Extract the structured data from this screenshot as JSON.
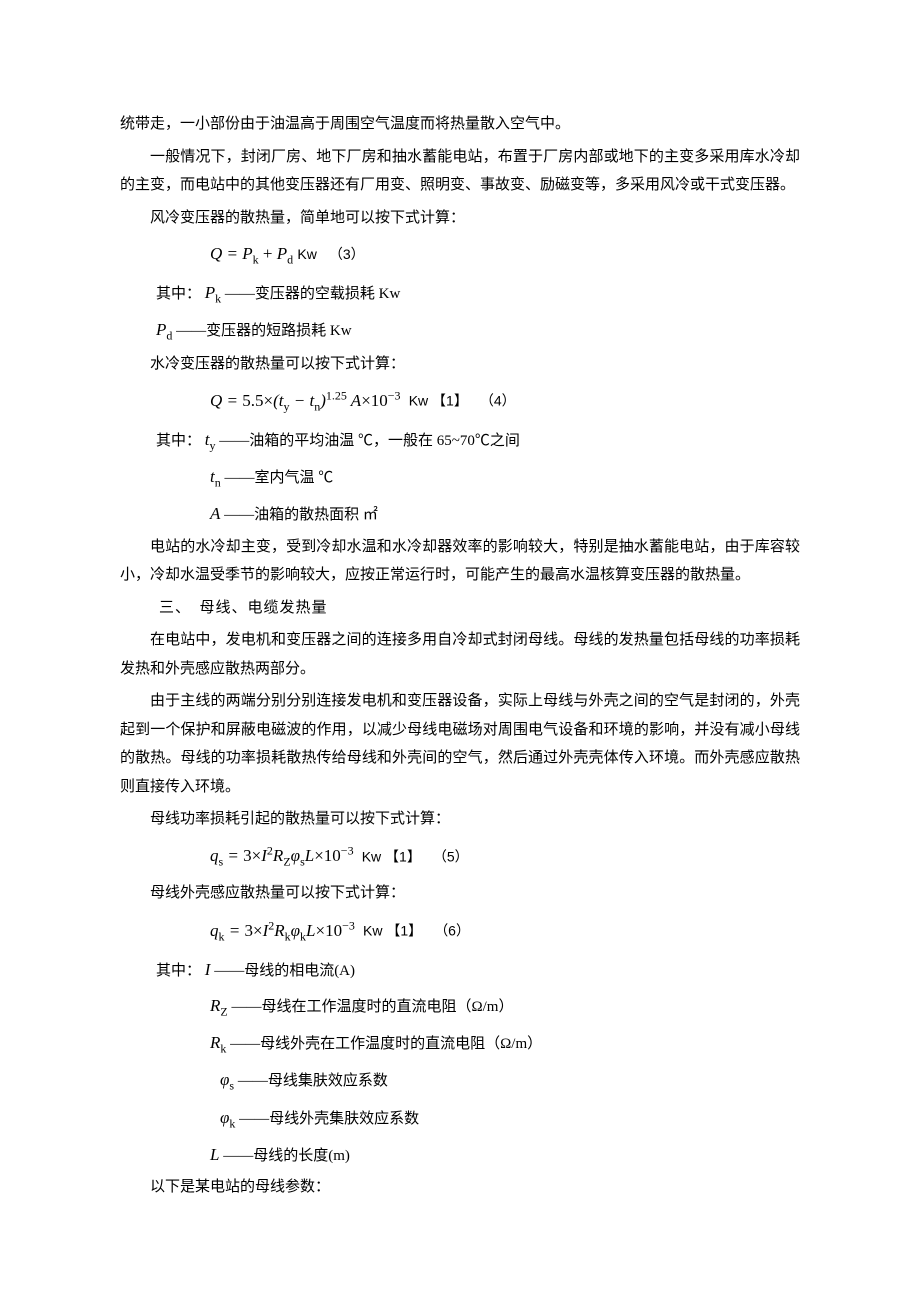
{
  "p1": "统带走，一小部份由于油温高于周围空气温度而将热量散入空气中。",
  "p2": "一般情况下，封闭厂房、地下厂房和抽水蓄能电站，布置于厂房内部或地下的主变多采用库水冷却的主变，而电站中的其他变压器还有厂用变、照明变、事故变、励磁变等，多采用风冷或干式变压器。",
  "p3": "风冷变压器的散热量，简单地可以按下式计算：",
  "eq3": {
    "text": "Q = P<span class=\"sub\">k</span> <span class=\"upright\">+</span> P<span class=\"sub\">d</span>",
    "unit": "Kw",
    "num": "（3）"
  },
  "def_pk_var": "P<span class=\"sub\">k</span>",
  "def_pk": "——变压器的空载损耗 Kw",
  "def_pd_var": "P<span class=\"sub\">d</span>",
  "def_pd": "——变压器的短路损耗 Kw",
  "p4": "水冷变压器的散热量可以按下式计算：",
  "eq4": {
    "text": "Q = <span class=\"upright\">5.5×</span>(t<span class=\"sub\">y</span> − t<span class=\"sub\">n</span>)<span class=\"sup\">1.25</span> A<span class=\"upright\">×10</span><span class=\"sup\">−3</span>",
    "unit": "Kw 【1】",
    "num": "（4）"
  },
  "def_ty_var": "t<span class=\"sub\">y</span>",
  "def_ty": "——油箱的平均油温 ℃，一般在 65~70℃之间",
  "def_tn_var": "t<span class=\"sub\">n</span>",
  "def_tn": "——室内气温 ℃",
  "def_A_var": "A",
  "def_A": "——油箱的散热面积 ㎡",
  "p5": "电站的水冷却主变，受到冷却水温和水冷却器效率的影响较大，特别是抽水蓄能电站，由于库容较小，冷却水温受季节的影响较大，应按正常运行时，可能产生的最高水温核算变压器的散热量。",
  "sec3": "三、　母线、电缆发热量",
  "p6": "在电站中，发电机和变压器之间的连接多用自冷却式封闭母线。母线的发热量包括母线的功率损耗发热和外壳感应散热两部分。",
  "p7": "由于主线的两端分别分别连接发电机和变压器设备，实际上母线与外壳之间的空气是封闭的，外壳起到一个保护和屏蔽电磁波的作用，以减少母线电磁场对周围电气设备和环境的影响，并没有减小母线的散热。母线的功率损耗散热传给母线和外壳间的空气，然后通过外壳壳体传入环境。而外壳感应散热则直接传入环境。",
  "p8": "母线功率损耗引起的散热量可以按下式计算：",
  "eq5": {
    "text": "q<span class=\"sub\">s</span> = <span class=\"upright\">3×</span>I<span class=\"sup\">2</span>R<span class=\"sub\">Z</span>φ<span class=\"sub\">s</span>L<span class=\"upright\">×10</span><span class=\"sup\">−3</span>",
    "unit": "Kw 【1】",
    "num": "（5）"
  },
  "p9": "母线外壳感应散热量可以按下式计算：",
  "eq6": {
    "text": "q<span class=\"sub\">k</span> = <span class=\"upright\">3×</span>I<span class=\"sup\">2</span>R<span class=\"sub\">k</span>φ<span class=\"sub\">k</span>L<span class=\"upright\">×10</span><span class=\"sup\">−3</span>",
    "unit": "Kw 【1】",
    "num": "（6）"
  },
  "def_I_var": "I",
  "def_I": "——母线的相电流(A)",
  "def_Rz_var": "R<span class=\"sub\">Z</span>",
  "def_Rz": "——母线在工作温度时的直流电阻（Ω/m）",
  "def_Rk_var": "R<span class=\"sub\">k</span>",
  "def_Rk": "——母线外壳在工作温度时的直流电阻（Ω/m）",
  "def_phis_var": "φ<span class=\"sub\">s</span>",
  "def_phis": "——母线集肤效应系数",
  "def_phik_var": "φ<span class=\"sub\">k</span>",
  "def_phik": "——母线外壳集肤效应系数",
  "def_L_var": "L",
  "def_L": "——母线的长度(m)",
  "p10": "以下是某电站的母线参数：",
  "where_label": "其中："
}
